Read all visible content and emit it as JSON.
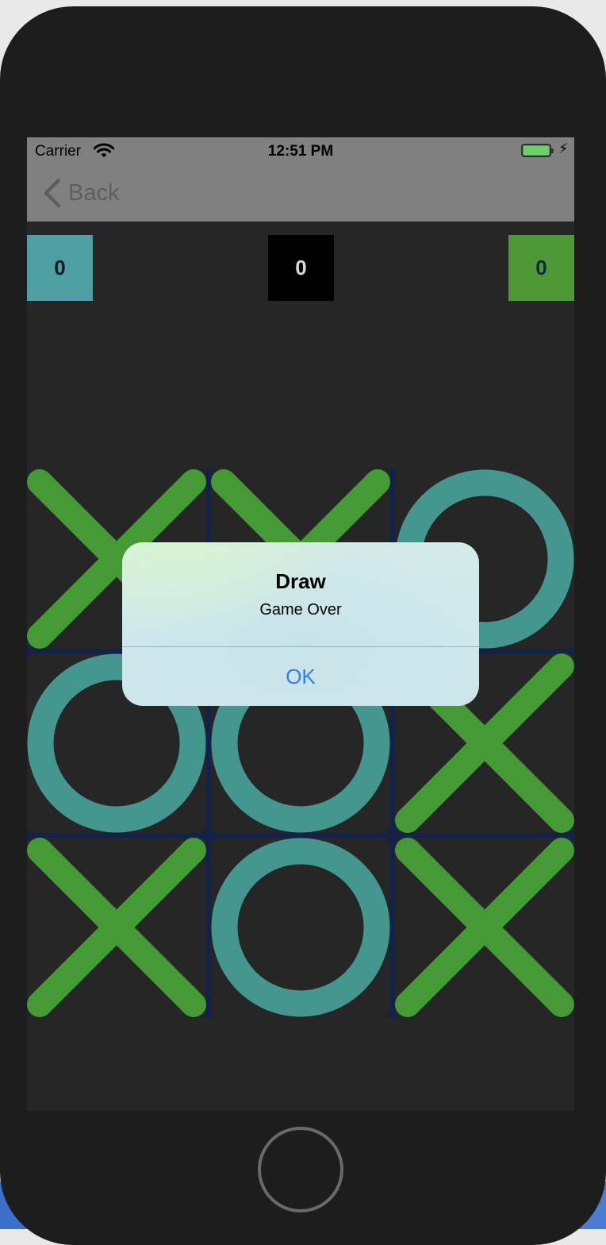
{
  "status_bar": {
    "carrier": "Carrier",
    "time": "12:51 PM",
    "wifi_icon": "wifi-icon",
    "battery_icon": "battery-charging-icon"
  },
  "nav": {
    "back_label": "Back",
    "back_icon": "chevron-left-icon"
  },
  "scores": {
    "x_wins": "0",
    "draws": "0",
    "o_wins": "0"
  },
  "board": {
    "cells": [
      "X",
      "X",
      "O",
      "O",
      "O",
      "X",
      "X",
      "O",
      "X"
    ]
  },
  "alert": {
    "title": "Draw",
    "message": "Game Over",
    "button": "OK"
  },
  "colors": {
    "x_mark": "#459a36",
    "o_mark": "#45968f",
    "board_lines": "#13224a",
    "alert_button": "#2f7ff0"
  }
}
